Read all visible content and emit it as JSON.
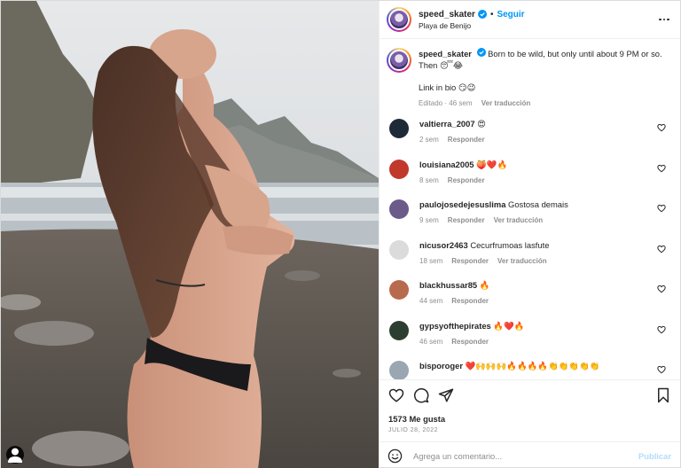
{
  "post": {
    "username": "speed_skater",
    "follow_label": "Seguir",
    "location": "Playa de Benijo",
    "caption_line1": "Born to be wild, but only until about 9 PM or so. Then 😴😂",
    "caption_line2": "Link in bio 😏😉",
    "caption_meta_edited": "Editado · 46 sem",
    "caption_meta_translate": "Ver traducción"
  },
  "comments": [
    {
      "username": "valtierra_2007",
      "text": "😍",
      "time": "2 sem",
      "reply": "Responder",
      "translate": "",
      "avatar_color": "#1e2a38"
    },
    {
      "username": "louisiana2005",
      "text": "🍑❤️🔥",
      "time": "8 sem",
      "reply": "Responder",
      "translate": "",
      "avatar_color": "#c0392b"
    },
    {
      "username": "paulojosedejesuslima",
      "text": "Gostosa demais",
      "time": "9 sem",
      "reply": "Responder",
      "translate": "Ver traducción",
      "avatar_color": "#6b5a8a"
    },
    {
      "username": "nicusor2463",
      "text": "Cecurfrumoas lasfute",
      "time": "18 sem",
      "reply": "Responder",
      "translate": "Ver traducción",
      "avatar_color": "#dbdbdb"
    },
    {
      "username": "blackhussar85",
      "text": "🔥",
      "time": "44 sem",
      "reply": "Responder",
      "translate": "",
      "avatar_color": "#b86a4e"
    },
    {
      "username": "gypsyofthepirates",
      "text": "🔥❤️🔥",
      "time": "46 sem",
      "reply": "Responder",
      "translate": "",
      "avatar_color": "#2c3e30"
    },
    {
      "username": "bisporoger",
      "text": "❤️🙌🙌🙌🔥🔥🔥🔥👏👏👏👏👏",
      "time": "",
      "reply": "",
      "translate": "",
      "avatar_color": "#9aa6b2"
    }
  ],
  "footer": {
    "likes": "1573 Me gusta",
    "date": "JULIO 28, 2022",
    "comment_placeholder": "Agrega un comentario...",
    "publish_label": "Publicar"
  },
  "icons": {
    "verified": "verified-badge-icon",
    "more": "more-options-icon",
    "like": "heart-icon",
    "comment": "comment-icon",
    "share": "share-icon",
    "save": "bookmark-icon",
    "emoji": "emoji-icon",
    "tag": "tagged-user-icon"
  },
  "colors": {
    "accent": "#0095f6",
    "publish_disabled": "#b3dbff",
    "secondary_text": "#8e8e8e",
    "verified": "#0095f6"
  }
}
